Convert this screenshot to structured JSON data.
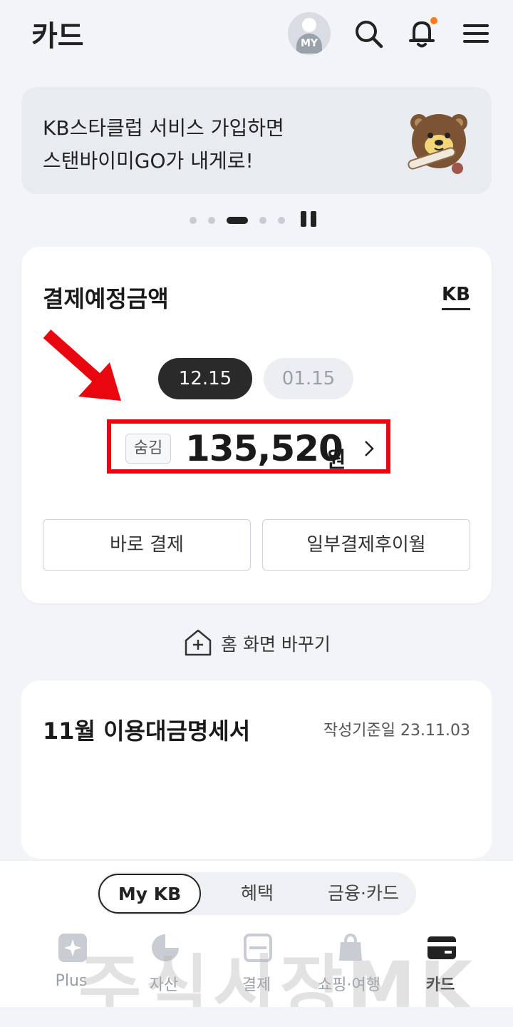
{
  "header": {
    "title": "카드",
    "avatar_label": "MY",
    "icons": [
      "search-icon",
      "bell-icon",
      "menu-icon"
    ]
  },
  "banner": {
    "line1": "KB스타클럽 서비스 가입하면",
    "line2": "스탠바이미GO가 내게로!"
  },
  "carousel": {
    "total": 5,
    "active_index": 2
  },
  "payment_card": {
    "title": "결제예정금액",
    "brand": "KB",
    "dates": [
      "12.15",
      "01.15"
    ],
    "selected_date": "12.15",
    "hide_label": "숨김",
    "amount": "135,520",
    "currency": "원",
    "buttons": [
      "바로 결제",
      "일부결제후이월"
    ]
  },
  "home_change": {
    "label": "홈 화면 바꾸기"
  },
  "statement_card": {
    "title": "11월 이용대금명세서",
    "date_label": "작성기준일 23.11.03"
  },
  "segment": {
    "items": [
      "My KB",
      "혜택",
      "금융·카드"
    ],
    "active": "My KB"
  },
  "bottom_nav": {
    "items": [
      {
        "label": "Plus",
        "icon": "sparkle-icon"
      },
      {
        "label": "자산",
        "icon": "pie-chart-icon"
      },
      {
        "label": "결제",
        "icon": "scan-icon"
      },
      {
        "label": "쇼핑·여행",
        "icon": "shopping-bag-icon"
      },
      {
        "label": "카드",
        "icon": "card-icon"
      }
    ],
    "active": "카드"
  },
  "watermark": "주식시장MK",
  "colors": {
    "highlight_red": "#e8070f",
    "notification_dot": "#ff7a1a",
    "background": "#f3f4f7"
  }
}
